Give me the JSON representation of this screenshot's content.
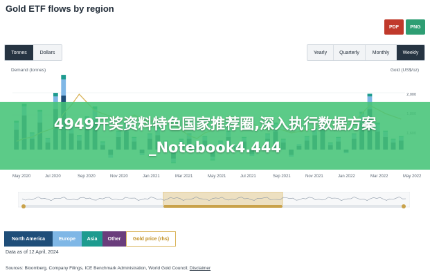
{
  "page": {
    "title": "Gold ETF flows by region"
  },
  "export": {
    "pdf": "PDF",
    "png": "PNG"
  },
  "units": [
    {
      "label": "Tonnes",
      "active": true
    },
    {
      "label": "Dollars",
      "active": false
    }
  ],
  "periods": [
    {
      "label": "Yearly",
      "active": false
    },
    {
      "label": "Quarterly",
      "active": false
    },
    {
      "label": "Monthly",
      "active": false
    },
    {
      "label": "Weekly",
      "active": true
    }
  ],
  "axes": {
    "left_label": "Demand (tonnes)",
    "right_label": "Gold (US$/oz)",
    "right_ticks": [
      "2,000",
      "1,800",
      "1,600"
    ],
    "left_ticks": [
      "60",
      "30",
      "0"
    ]
  },
  "overlay": {
    "text": "4949开奖资料特色国家推荐圈,深入执行数据方案_Notebook4.444"
  },
  "x_ticks": [
    "May 2020",
    "Jul 2020",
    "Sep 2020",
    "Nov 2020",
    "Jan 2021",
    "Mar 2021",
    "May 2021",
    "Jul 2021",
    "Sep 2021",
    "Nov 2021",
    "Jan 2022",
    "Mar 2022",
    "May 2022"
  ],
  "legend": {
    "north_america": "North America",
    "europe": "Europe",
    "asia": "Asia",
    "other": "Other",
    "gold_price": "Gold price (rhs)"
  },
  "footer": {
    "date_note": "Data as of 12 April, 2024",
    "sources_prefix": "Sources: Bloomberg, Company Filings, ICE Benchmark Administration, World Gold Council;",
    "disclaimer": "Disclaimer"
  },
  "colors": {
    "north_america": "#1f4e79",
    "europe": "#7fb7e6",
    "asia": "#1d9b8f",
    "other": "#6a3d7c",
    "gold_price": "#d9b45a",
    "pdf": "#c0392b",
    "png": "#2e9e73"
  },
  "chart_data": {
    "type": "bar",
    "x_ticks": [
      "May 2020",
      "Jul 2020",
      "Sep 2020",
      "Nov 2020",
      "Jan 2021",
      "Mar 2021",
      "May 2021",
      "Jul 2021",
      "Sep 2021",
      "Nov 2021",
      "Jan 2022",
      "Mar 2022",
      "May 2022"
    ],
    "series": [
      {
        "name": "North America",
        "values": [
          22,
          38,
          12,
          30,
          8,
          45,
          60,
          18,
          10,
          25,
          33,
          5,
          -6,
          14,
          20,
          9,
          -4,
          12,
          16,
          6,
          -10,
          8,
          12,
          4,
          10,
          -8,
          6,
          14,
          3,
          9,
          -5,
          2,
          12,
          20,
          8,
          -6,
          4,
          10,
          16,
          25,
          5,
          9,
          -3,
          12,
          30,
          45,
          20,
          14,
          8,
          10
        ]
      },
      {
        "name": "Europe",
        "values": [
          8,
          10,
          6,
          12,
          4,
          14,
          18,
          9,
          5,
          10,
          12,
          3,
          -3,
          6,
          8,
          4,
          -2,
          5,
          7,
          3,
          -4,
          3,
          5,
          2,
          4,
          -3,
          3,
          6,
          2,
          4,
          -2,
          1,
          5,
          8,
          3,
          -2,
          2,
          4,
          6,
          9,
          2,
          4,
          -1,
          5,
          10,
          14,
          8,
          6,
          3,
          4
        ]
      },
      {
        "name": "Asia",
        "values": [
          2,
          3,
          1,
          2,
          1,
          4,
          5,
          2,
          1,
          2,
          3,
          1,
          0,
          1,
          2,
          1,
          0,
          1,
          2,
          1,
          -1,
          1,
          1,
          0,
          1,
          -1,
          1,
          1,
          0,
          1,
          0,
          0,
          1,
          2,
          1,
          0,
          0,
          1,
          2,
          2,
          1,
          1,
          0,
          1,
          2,
          3,
          2,
          1,
          1,
          1
        ]
      }
    ],
    "gold_price": [
      1700,
      1720,
      1730,
      1760,
      1780,
      1800,
      1900,
      1960,
      2040,
      1980,
      1920,
      1900,
      1880,
      1870,
      1860,
      1890,
      1860,
      1840,
      1870,
      1850,
      1820,
      1780,
      1740,
      1720,
      1760,
      1780,
      1830,
      1880,
      1870,
      1860,
      1830,
      1800,
      1780,
      1790,
      1780,
      1760,
      1770,
      1780,
      1800,
      1830,
      1820,
      1800,
      1810,
      1840,
      1900,
      1960,
      1930,
      1900,
      1880,
      1860
    ],
    "xlabel": "",
    "ylabel": "Demand (tonnes)",
    "y2label": "Gold (US$/oz)"
  }
}
